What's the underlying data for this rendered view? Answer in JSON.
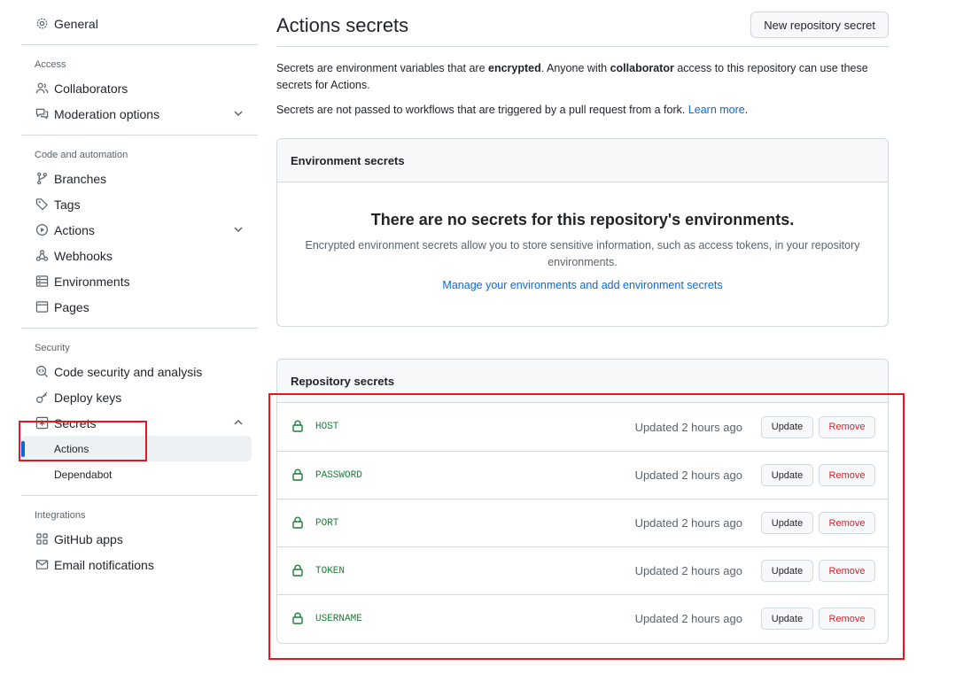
{
  "sidebar": {
    "general": "General",
    "sections": {
      "access": {
        "heading": "Access",
        "collaborators": "Collaborators",
        "moderation": "Moderation options"
      },
      "code": {
        "heading": "Code and automation",
        "branches": "Branches",
        "tags": "Tags",
        "actions": "Actions",
        "webhooks": "Webhooks",
        "environments": "Environments",
        "pages": "Pages"
      },
      "security": {
        "heading": "Security",
        "code_security": "Code security and analysis",
        "deploy_keys": "Deploy keys",
        "secrets": "Secrets",
        "secrets_actions": "Actions",
        "secrets_dependabot": "Dependabot"
      },
      "integrations": {
        "heading": "Integrations",
        "github_apps": "GitHub apps",
        "email": "Email notifications"
      }
    }
  },
  "main": {
    "title": "Actions secrets",
    "new_button": "New repository secret",
    "desc1_a": "Secrets are environment variables that are ",
    "desc1_b": "encrypted",
    "desc1_c": ". Anyone with ",
    "desc1_d": "collaborator",
    "desc1_e": " access to this repository can use these secrets for Actions.",
    "desc2_a": "Secrets are not passed to workflows that are triggered by a pull request from a fork. ",
    "desc2_link": "Learn more",
    "desc2_end": ".",
    "env": {
      "header": "Environment secrets",
      "blank_title": "There are no secrets for this repository's environments.",
      "blank_text": "Encrypted environment secrets allow you to store sensitive information, such as access tokens, in your repository environments.",
      "blank_link": "Manage your environments and add environment secrets"
    },
    "repo": {
      "header": "Repository secrets",
      "update_label": "Update",
      "remove_label": "Remove",
      "secrets": [
        {
          "name": "HOST",
          "updated": "Updated 2 hours ago"
        },
        {
          "name": "PASSWORD",
          "updated": "Updated 2 hours ago"
        },
        {
          "name": "PORT",
          "updated": "Updated 2 hours ago"
        },
        {
          "name": "TOKEN",
          "updated": "Updated 2 hours ago"
        },
        {
          "name": "USERNAME",
          "updated": "Updated 2 hours ago"
        }
      ]
    }
  },
  "colors": {
    "accent": "#0969da",
    "secret_green": "#1a7f37",
    "danger": "#d1242f",
    "annotation_red": "#e0181f"
  },
  "icons": {
    "general": "gear-icon",
    "collaborators": "people-icon",
    "moderation": "comment-discussion-icon",
    "branches": "git-branch-icon",
    "tags": "tag-icon",
    "actions": "play-icon",
    "webhooks": "webhook-icon",
    "environments": "server-icon",
    "pages": "browser-icon",
    "code_security": "codescan-icon",
    "deploy_keys": "key-icon",
    "secrets": "key-asterisk-icon",
    "github_apps": "apps-icon",
    "email": "mail-icon",
    "secret_row": "lock-icon"
  }
}
